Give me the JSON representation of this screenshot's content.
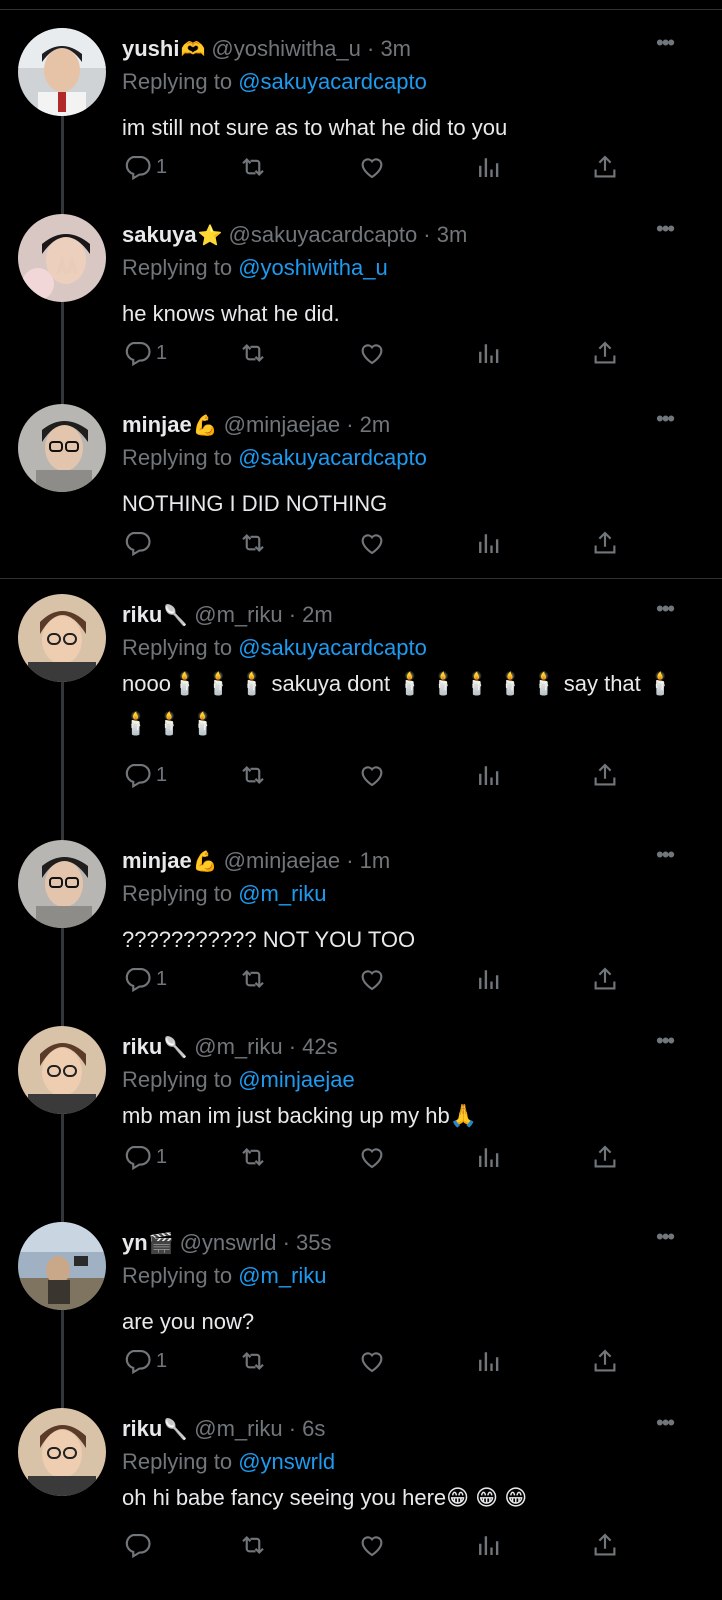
{
  "tweets": [
    {
      "name": "yushi",
      "name_emoji": "🫶",
      "handle": "@yoshiwitha_u · 3m",
      "replying_prefix": "Replying to",
      "replying_to": "@sakuyacardcapto",
      "text": "im still not sure as to what he did to you",
      "reply_count": "1"
    },
    {
      "name": "sakuya",
      "name_emoji": "⭐",
      "handle": "@sakuyacardcapto · 3m",
      "replying_prefix": "Replying to",
      "replying_to": "@yoshiwitha_u",
      "text": "he knows what he did.",
      "reply_count": "1"
    },
    {
      "name": "minjae",
      "name_emoji": "💪",
      "handle": "@minjaejae · 2m",
      "replying_prefix": "Replying to",
      "replying_to": "@sakuyacardcapto",
      "text": "NOTHING I DID NOTHING",
      "reply_count": ""
    },
    {
      "name": "riku",
      "name_emoji": "🥄",
      "handle": "@m_riku · 2m",
      "replying_prefix": "Replying to",
      "replying_to": "@sakuyacardcapto",
      "text": "nooo🕯️ 🕯️ 🕯️ sakuya dont 🕯️ 🕯️ 🕯️ 🕯️ 🕯️ say that 🕯️ 🕯️ 🕯️ 🕯️",
      "reply_count": "1"
    },
    {
      "name": "minjae",
      "name_emoji": "💪",
      "handle": "@minjaejae · 1m",
      "replying_prefix": "Replying to",
      "replying_to": "@m_riku",
      "text": "??????????? NOT YOU TOO",
      "reply_count": "1"
    },
    {
      "name": "riku",
      "name_emoji": "🥄",
      "handle": "@m_riku · 42s",
      "replying_prefix": "Replying to",
      "replying_to": "@minjaejae",
      "text": "mb man im just backing up my hb🙏",
      "reply_count": "1"
    },
    {
      "name": "yn",
      "name_emoji": "🎬",
      "handle": "@ynswrld · 35s",
      "replying_prefix": "Replying to",
      "replying_to": "@m_riku",
      "text": "are you now?",
      "reply_count": "1"
    },
    {
      "name": "riku",
      "name_emoji": "🥄",
      "handle": "@m_riku · 6s",
      "replying_prefix": "Replying to",
      "replying_to": "@ynswrld",
      "text": "oh hi babe fancy seeing you here😁 😁 😁",
      "reply_count": ""
    }
  ],
  "icons": {
    "reply": "reply-icon",
    "retweet": "retweet-icon",
    "like": "heart-icon",
    "views": "views-icon",
    "share": "share-icon",
    "more": "more-icon"
  },
  "colors": {
    "background": "#000000",
    "text": "#e7e9ea",
    "muted": "#71767b",
    "link": "#1d9bf0",
    "divider": "#2f3336"
  }
}
